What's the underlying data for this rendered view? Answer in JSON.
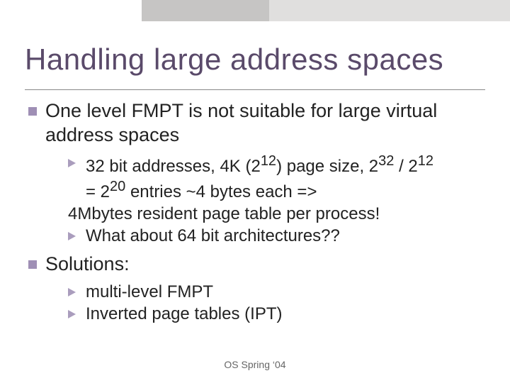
{
  "title": "Handling large address spaces",
  "footer": "OS Spring ‘04",
  "point1": {
    "text": "One level FMPT is not suitable for large virtual address spaces",
    "sub1": {
      "pre1": "32 bit addresses, 4K (2",
      "sup1": "12",
      "mid1": ") page size, 2",
      "sup2": "32",
      "mid2": " / 2",
      "sup3": "12",
      "line2a": "= 2",
      "sup4": "20",
      "line2b": " entries ~4 bytes each =>",
      "line3": "4Mbytes resident page table per process!"
    },
    "sub2": "What about 64 bit architectures??"
  },
  "point2": {
    "text": "Solutions:",
    "sub1": "multi-level FMPT",
    "sub2": "Inverted page tables (IPT)"
  }
}
